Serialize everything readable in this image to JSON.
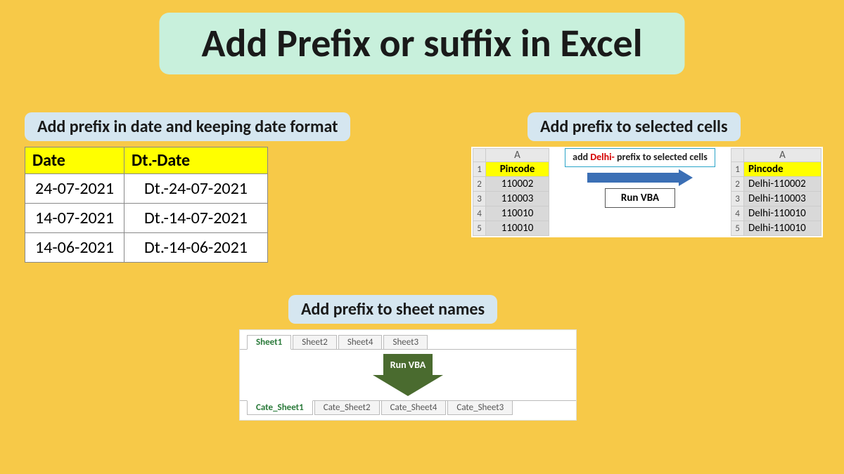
{
  "title": "Add Prefix or suffix in Excel",
  "dates": {
    "caption": "Add prefix in date and keeping date format",
    "headers": [
      "Date",
      "Dt.-Date"
    ],
    "rows": [
      [
        "24-07-2021",
        "Dt.-24-07-2021"
      ],
      [
        "14-07-2021",
        "Dt.-14-07-2021"
      ],
      [
        "14-06-2021",
        "Dt.-14-06-2021"
      ]
    ]
  },
  "cells": {
    "caption": "Add prefix to selected cells",
    "col_letter": "A",
    "before_header": "Pincode",
    "before_values": [
      "110002",
      "110003",
      "110010",
      "110010"
    ],
    "after_header": "Pincode",
    "after_values": [
      "Delhi-110002",
      "Delhi-110003",
      "Delhi-110010",
      "Delhi-110010"
    ],
    "note_prefix_word": "Delhi-",
    "note_pre": "add ",
    "note_post": " prefix to selected cells",
    "runvba": "Run VBA"
  },
  "sheets": {
    "caption": "Add prefix to sheet names",
    "before_tabs": [
      "Sheet1",
      "Sheet2",
      "Sheet4",
      "Sheet3"
    ],
    "after_tabs": [
      "Cate_Sheet1",
      "Cate_Sheet2",
      "Cate_Sheet4",
      "Cate_Sheet3"
    ],
    "runvba": "Run VBA"
  }
}
